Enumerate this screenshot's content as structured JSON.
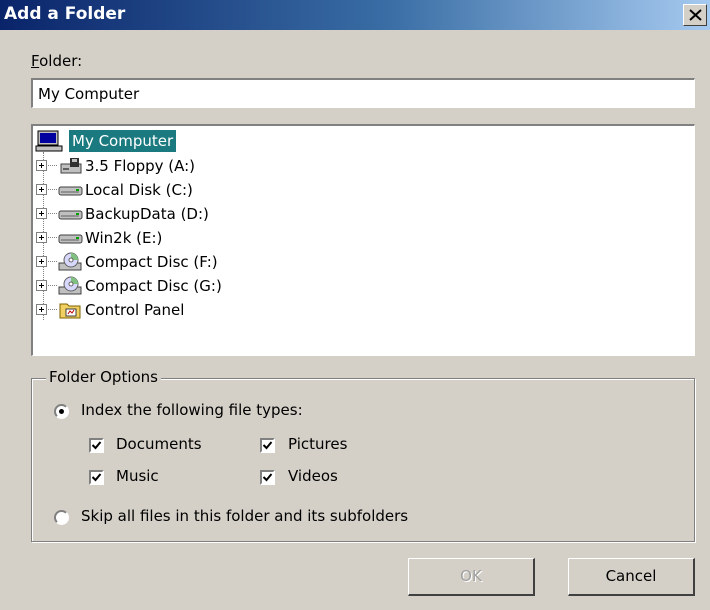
{
  "window": {
    "title": "Add a Folder"
  },
  "folder": {
    "label_prefix": "F",
    "label_rest": "older:",
    "value": "My Computer"
  },
  "tree": {
    "root": {
      "label": "My Computer",
      "icon": "computer-icon"
    },
    "items": [
      {
        "label": "3.5 Floppy (A:)",
        "icon": "floppy-drive-icon"
      },
      {
        "label": "Local Disk (C:)",
        "icon": "hard-disk-icon"
      },
      {
        "label": "BackupData (D:)",
        "icon": "hard-disk-icon"
      },
      {
        "label": "Win2k (E:)",
        "icon": "hard-disk-icon"
      },
      {
        "label": "Compact Disc (F:)",
        "icon": "cd-drive-icon"
      },
      {
        "label": "Compact Disc (G:)",
        "icon": "cd-drive-icon"
      },
      {
        "label": "Control Panel",
        "icon": "control-panel-icon"
      }
    ]
  },
  "options": {
    "legend": "Folder Options",
    "index_label": "Index the following file types:",
    "index_selected": true,
    "types": [
      {
        "label": "Documents",
        "checked": true
      },
      {
        "label": "Pictures",
        "checked": true
      },
      {
        "label": "Music",
        "checked": true
      },
      {
        "label": "Videos",
        "checked": true
      }
    ],
    "skip_label": "Skip all files in this folder and its subfolders",
    "skip_selected": false
  },
  "buttons": {
    "ok": "OK",
    "cancel": "Cancel",
    "ok_enabled": false
  },
  "colors": {
    "selection": "#1b7a80",
    "titlebar_start": "#0a246a",
    "face": "#d4d0c8"
  }
}
